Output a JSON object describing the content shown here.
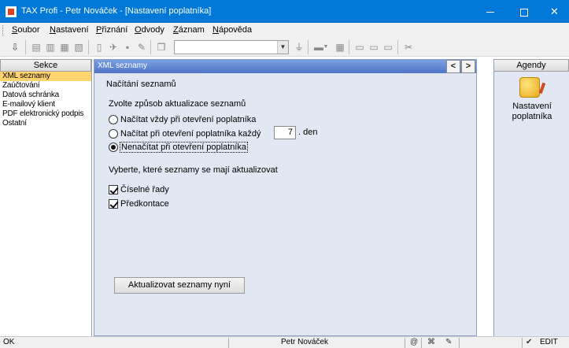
{
  "window": {
    "title": "TAX Profi - Petr Nováček - [Nastavení poplatníka]",
    "controls": {
      "minimize": "—",
      "maximize": "☐",
      "close": "✕"
    }
  },
  "menu": {
    "items": [
      "Soubor",
      "Nastavení",
      "Přiznání",
      "Odvody",
      "Záznam",
      "Nápověda"
    ]
  },
  "toolbar": {
    "combo_value": "",
    "icons": [
      "import-icon",
      "export-icon",
      "copy-icon",
      "print-icon",
      "new-doc-icon",
      "send-icon",
      "save-icon",
      "edit-icon",
      "pages-icon",
      "filter-icon",
      "folder-icon",
      "calc-icon",
      "list-icon",
      "list2-icon",
      "list3-icon",
      "tools-icon"
    ]
  },
  "left_panel": {
    "header": "Sekce",
    "items": [
      "XML seznamy",
      "Zaúčtování",
      "Datová schránka",
      "E-mailový klient",
      "PDF elektronický podpis",
      "Ostatní"
    ],
    "selected_index": 0
  },
  "main": {
    "header": "XML seznamy",
    "nav_prev": "<",
    "nav_next": ">",
    "section_title": "Načítání seznamů",
    "group1_title": "Zvolte způsob aktualizace seznamů",
    "radios": [
      {
        "label": "Načítat vždy při otevření poplatníka",
        "checked": false
      },
      {
        "label": "Načítat při otevření poplatníka každý",
        "checked": false
      },
      {
        "label": "Nenačítat při otevření poplatníka",
        "checked": true
      }
    ],
    "day_value": "7",
    "day_suffix": ". den",
    "group2_title": "Vyberte, které seznamy se mají aktualizovat",
    "checkboxes": [
      {
        "label": "Číselné řady",
        "checked": true
      },
      {
        "label": "Předkontace",
        "checked": true
      }
    ],
    "update_button": "Aktualizovat seznamy nyní"
  },
  "right_panel": {
    "header": "Agendy",
    "item_label": "Nastavení poplatníka"
  },
  "status": {
    "left": "OK",
    "user": "Petr Nováček",
    "mode": "EDIT"
  }
}
